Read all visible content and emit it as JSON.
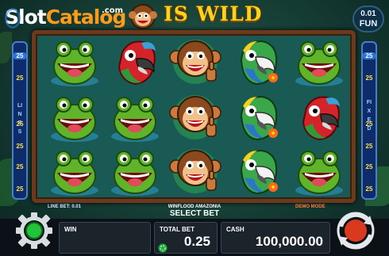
{
  "header": {
    "logo_slot": "Slot",
    "logo_catalog": "Catalog",
    "logo_com": ".com",
    "wild_text": "IS WILD",
    "coin_value": "0.01",
    "coin_currency": "FUN"
  },
  "lines": {
    "left_numbers": [
      "25",
      "25",
      "25",
      "25",
      "25",
      "25",
      "25"
    ],
    "right_numbers": [
      "25",
      "25",
      "25",
      "25",
      "25",
      "25",
      "25"
    ],
    "left_label": "LINES",
    "right_label": "FIXED"
  },
  "reels": [
    [
      "frog",
      "frog",
      "frog"
    ],
    [
      "parrot-red",
      "frog",
      "frog"
    ],
    [
      "monkey",
      "monkey",
      "monkey"
    ],
    [
      "parrot-green",
      "parrot-green",
      "parrot-green"
    ],
    [
      "frog",
      "parrot-red",
      "frog"
    ]
  ],
  "info": {
    "line_bet": "LINE BET: 0.01",
    "game_name": "WINFLOOD AMAZONIA",
    "demo_mode": "DEMO MODE",
    "select_bet": "SELECT BET"
  },
  "bottom": {
    "win_label": "WIN",
    "win_value": "",
    "total_bet_label": "TOTAL BET",
    "total_bet_value": "0.25",
    "cash_label": "CASH",
    "cash_value": "100,000.00"
  },
  "colors": {
    "wild_gold": "#ffd21a",
    "logo_orange": "#ff9a1a",
    "reel_background": "#1a5a55",
    "frame_wood": "#6b3a1c",
    "panel_blue": "#0e2c6a",
    "demo_orange": "#ff7b3a"
  }
}
